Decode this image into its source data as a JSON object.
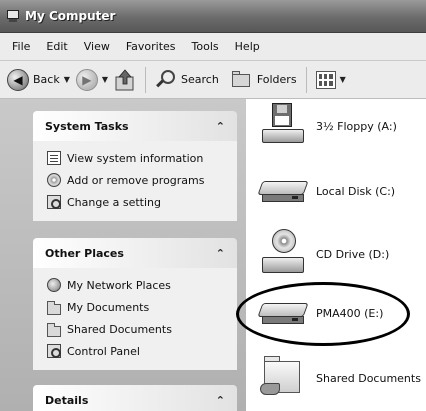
{
  "window": {
    "title": "My Computer",
    "title_icon": "my-computer-icon"
  },
  "menu": [
    "File",
    "Edit",
    "View",
    "Favorites",
    "Tools",
    "Help"
  ],
  "toolbar": {
    "back_label": "Back",
    "search_label": "Search",
    "folders_label": "Folders"
  },
  "left": {
    "system_tasks": {
      "title": "System Tasks",
      "items": [
        {
          "label": "View system information",
          "icon": "system-info-icon"
        },
        {
          "label": "Add or remove programs",
          "icon": "add-remove-programs-icon"
        },
        {
          "label": "Change a setting",
          "icon": "control-panel-icon"
        }
      ]
    },
    "other_places": {
      "title": "Other Places",
      "items": [
        {
          "label": "My Network Places",
          "icon": "network-places-icon"
        },
        {
          "label": "My Documents",
          "icon": "folder-icon"
        },
        {
          "label": "Shared Documents",
          "icon": "folder-icon"
        },
        {
          "label": "Control Panel",
          "icon": "control-panel-icon"
        }
      ]
    },
    "details": {
      "title": "Details"
    }
  },
  "drives": [
    {
      "label": "3½ Floppy (A:)",
      "icon": "floppy-drive-icon"
    },
    {
      "label": "Local Disk (C:)",
      "icon": "hard-disk-icon"
    },
    {
      "label": "CD Drive (D:)",
      "icon": "cd-drive-icon"
    },
    {
      "label": "PMA400 (E:)",
      "icon": "removable-disk-icon",
      "highlighted": true
    },
    {
      "label": "Shared Documents",
      "icon": "shared-folder-icon"
    }
  ],
  "colors": {
    "title_bar": "#6b6b6b",
    "task_pane": "#b0b0b0",
    "highlight_ring": "#000000"
  }
}
